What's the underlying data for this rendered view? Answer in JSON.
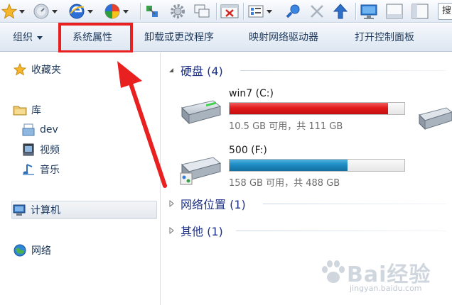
{
  "toolbar": {
    "icons": [
      "favorites-star-icon",
      "history-icon",
      "ie-icon",
      "media-icon",
      "share-network-icon",
      "gear-icon",
      "window-copy-icon",
      "close-window-icon",
      "view-grid-icon",
      "connect-icon",
      "delete-x-icon",
      "up-arrow-icon",
      "monitor-icon",
      "window-icon",
      "panel-icon"
    ],
    "search_stub": "搜"
  },
  "command_bar": {
    "organize": "组织",
    "system_properties": "系统属性",
    "uninstall": "卸载或更改程序",
    "map_drive": "映射网络驱动器",
    "control_panel": "打开控制面板"
  },
  "nav": {
    "favorites": "收藏夹",
    "libraries": "库",
    "library_items": [
      "dev",
      "视频",
      "音乐"
    ],
    "computer": "计算机",
    "network": "网络"
  },
  "content": {
    "groups": {
      "hard_disks": "硬盘 (4)",
      "network_locations": "网络位置 (1)",
      "other": "其他 (1)"
    },
    "drives": [
      {
        "name": "win7 (C:)",
        "space": "10.5 GB 可用，共 111 GB",
        "used_fraction": 0.906,
        "color": "#e11b1b"
      },
      {
        "name": "500 (F:)",
        "space": "158 GB 可用，共 488 GB",
        "used_fraction": 0.676,
        "color": "#1e8cc4"
      }
    ]
  },
  "watermark": {
    "brand": "Bai经验",
    "url": "jingyan.baidu.com"
  },
  "colors": {
    "highlight": "#e8201f",
    "accent_text": "#1e3287"
  }
}
